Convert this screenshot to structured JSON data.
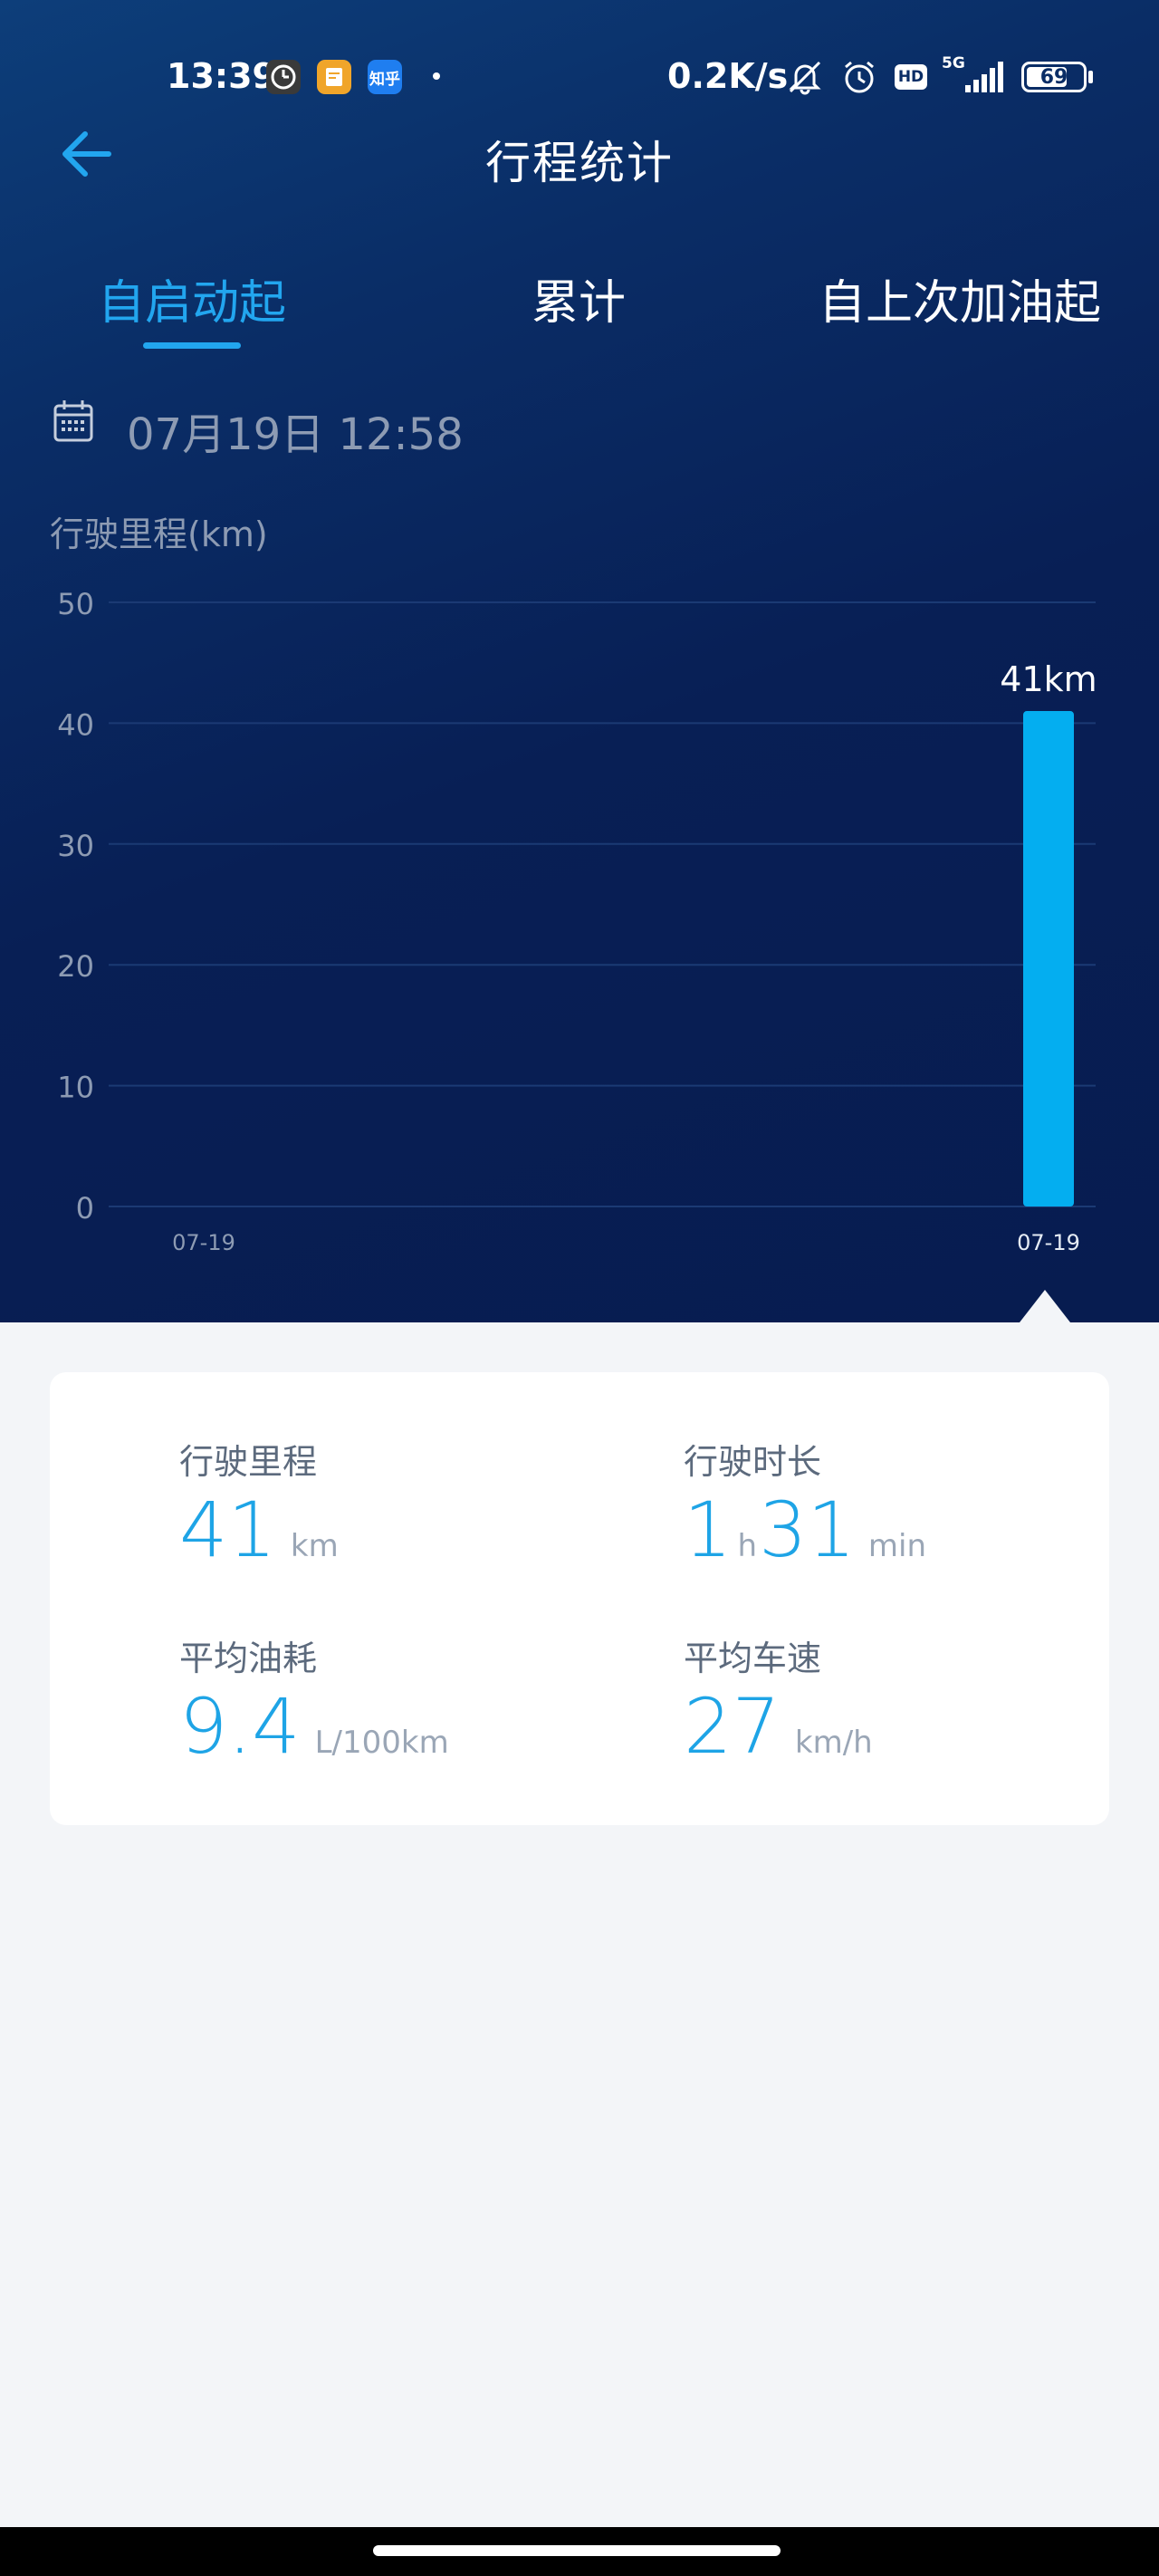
{
  "status_bar": {
    "time": "13:39",
    "net_speed": "0.2K/s",
    "network": "5G",
    "hd_badge": "HD",
    "battery": "69",
    "apps": [
      {
        "name": "clock-app-icon",
        "color": "#3a3a3a"
      },
      {
        "name": "notes-app-icon",
        "color": "#f0a52a"
      },
      {
        "name": "zhihu-app-icon",
        "color": "#1f7ef0",
        "label": "知乎"
      }
    ]
  },
  "header": {
    "title": "行程统计"
  },
  "tabs": [
    {
      "label": "自启动起",
      "active": true
    },
    {
      "label": "累计",
      "active": false
    },
    {
      "label": "自上次加油起",
      "active": false
    }
  ],
  "date": {
    "text": "07月19日 12:58"
  },
  "chart_data": {
    "type": "bar",
    "ylabel": "行驶里程(km)",
    "ylim": [
      0,
      50
    ],
    "yticks": [
      0,
      10,
      20,
      30,
      40,
      50
    ],
    "grid": true,
    "categories": [
      "07-19",
      "07-19"
    ],
    "values": [
      null,
      41
    ],
    "data_labels": [
      "",
      "41km"
    ],
    "bar_color": "#04aef0"
  },
  "stats": [
    {
      "label": "行驶里程",
      "value": "41",
      "unit": "km"
    },
    {
      "label": "行驶时长",
      "hours": "1",
      "hours_unit": "h",
      "minutes": "31",
      "minutes_unit": "min"
    },
    {
      "label": "平均油耗",
      "value": "9.4",
      "unit": "L/100km"
    },
    {
      "label": "平均车速",
      "value": "27",
      "unit": "km/h"
    }
  ],
  "colors": {
    "accent": "#22a6ef",
    "value": "#1ea4e6",
    "header_bg": "#0a2d66"
  }
}
